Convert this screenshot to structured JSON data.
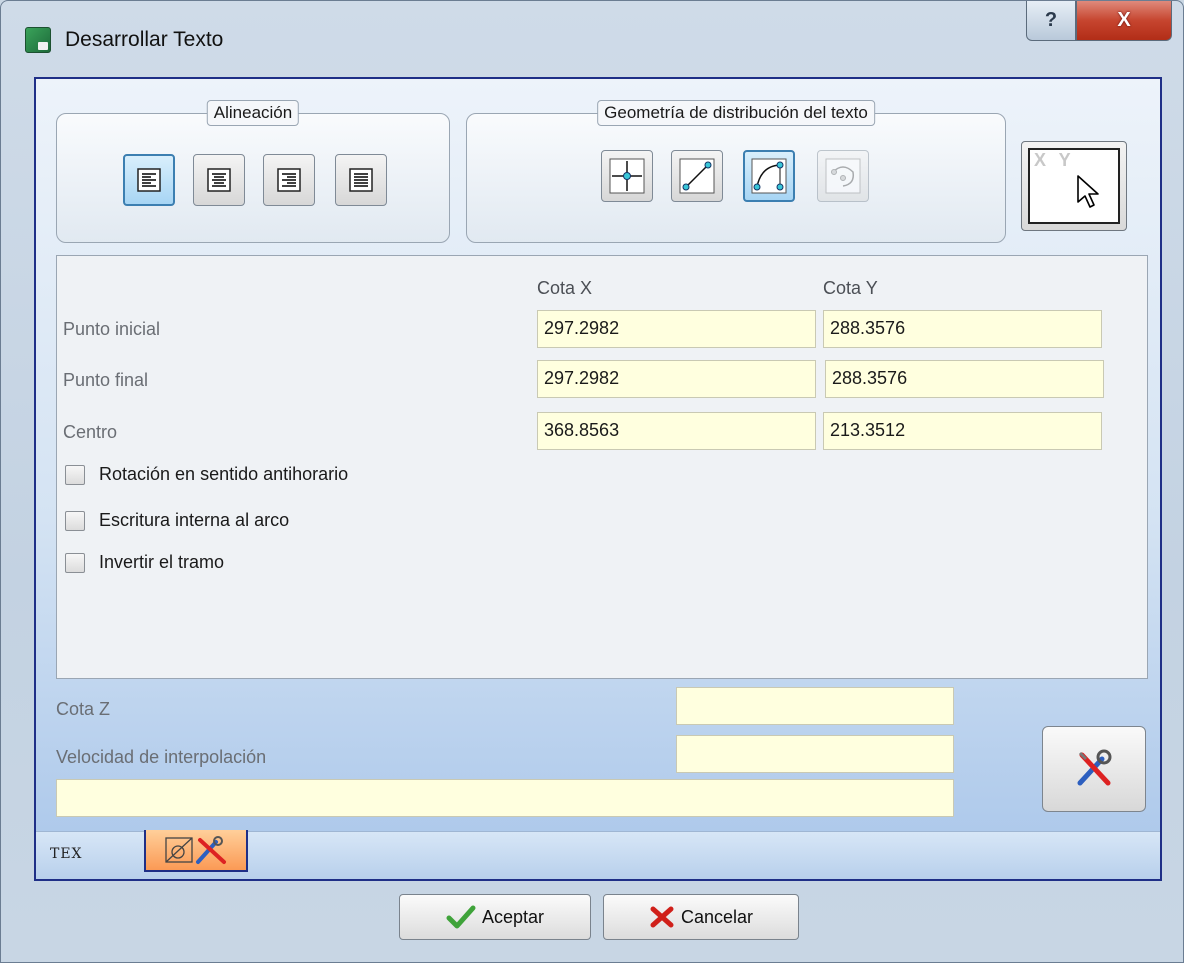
{
  "window": {
    "title": "Desarrollar Texto",
    "help_symbol": "?",
    "close_symbol": "X"
  },
  "alignment_group": {
    "title": "Alineación",
    "buttons": [
      {
        "icon": "align-left-icon",
        "active": true
      },
      {
        "icon": "align-center-icon",
        "active": false
      },
      {
        "icon": "align-right-icon",
        "active": false
      },
      {
        "icon": "align-justify-icon",
        "active": false
      }
    ]
  },
  "geometry_group": {
    "title": "Geometría de distribución del texto",
    "buttons": [
      {
        "icon": "point-geometry-icon",
        "active": false
      },
      {
        "icon": "line-geometry-icon",
        "active": false
      },
      {
        "icon": "arc-geometry-icon",
        "active": true
      },
      {
        "icon": "circle-geometry-icon",
        "disabled": true
      }
    ]
  },
  "xy_pick_button": {
    "label": "X Y",
    "icon": "cursor-arrow-icon"
  },
  "coordinates": {
    "col_x": "Cota X",
    "col_y": "Cota Y",
    "rows": [
      {
        "label": "Punto inicial",
        "x": "297.2982",
        "y": "288.3576"
      },
      {
        "label": "Punto final",
        "x": "297.2982",
        "y": "288.3576"
      },
      {
        "label": "Centro",
        "x": "368.8563",
        "y": "213.3512"
      }
    ]
  },
  "options": {
    "ccw": {
      "label": "Rotación en sentido antihorario",
      "checked": false
    },
    "internal": {
      "label": "Escritura interna al arco",
      "checked": false
    },
    "invert": {
      "label": "Invertir el tramo",
      "checked": false
    }
  },
  "lower": {
    "z_label": "Cota Z",
    "z_value": "",
    "speed_label": "Velocidad de interpolación",
    "speed_value": "",
    "comment_value": ""
  },
  "tabs": {
    "text_tab_label": "TEX",
    "geometry_tab_icon": "geometry-tools-icon"
  },
  "footer": {
    "accept_label": "Aceptar",
    "cancel_label": "Cancelar"
  },
  "colors": {
    "field_bg": "#ffffdf",
    "frame_border": "#1f2f87",
    "active_tab": "#fb9a55"
  }
}
